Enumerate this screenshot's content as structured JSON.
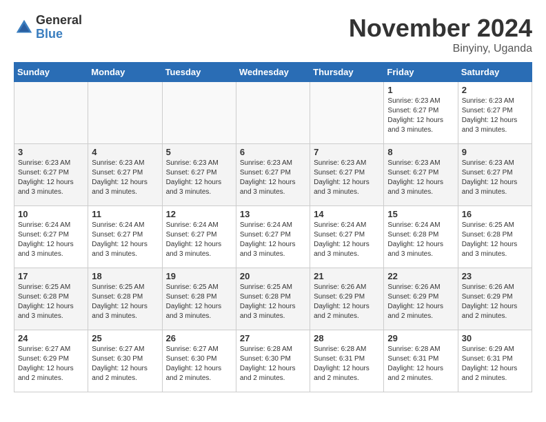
{
  "logo": {
    "general": "General",
    "blue": "Blue"
  },
  "title": "November 2024",
  "location": "Binyiny, Uganda",
  "days_of_week": [
    "Sunday",
    "Monday",
    "Tuesday",
    "Wednesday",
    "Thursday",
    "Friday",
    "Saturday"
  ],
  "weeks": [
    [
      {
        "day": "",
        "info": ""
      },
      {
        "day": "",
        "info": ""
      },
      {
        "day": "",
        "info": ""
      },
      {
        "day": "",
        "info": ""
      },
      {
        "day": "",
        "info": ""
      },
      {
        "day": "1",
        "info": "Sunrise: 6:23 AM\nSunset: 6:27 PM\nDaylight: 12 hours and 3 minutes."
      },
      {
        "day": "2",
        "info": "Sunrise: 6:23 AM\nSunset: 6:27 PM\nDaylight: 12 hours and 3 minutes."
      }
    ],
    [
      {
        "day": "3",
        "info": "Sunrise: 6:23 AM\nSunset: 6:27 PM\nDaylight: 12 hours and 3 minutes."
      },
      {
        "day": "4",
        "info": "Sunrise: 6:23 AM\nSunset: 6:27 PM\nDaylight: 12 hours and 3 minutes."
      },
      {
        "day": "5",
        "info": "Sunrise: 6:23 AM\nSunset: 6:27 PM\nDaylight: 12 hours and 3 minutes."
      },
      {
        "day": "6",
        "info": "Sunrise: 6:23 AM\nSunset: 6:27 PM\nDaylight: 12 hours and 3 minutes."
      },
      {
        "day": "7",
        "info": "Sunrise: 6:23 AM\nSunset: 6:27 PM\nDaylight: 12 hours and 3 minutes."
      },
      {
        "day": "8",
        "info": "Sunrise: 6:23 AM\nSunset: 6:27 PM\nDaylight: 12 hours and 3 minutes."
      },
      {
        "day": "9",
        "info": "Sunrise: 6:23 AM\nSunset: 6:27 PM\nDaylight: 12 hours and 3 minutes."
      }
    ],
    [
      {
        "day": "10",
        "info": "Sunrise: 6:24 AM\nSunset: 6:27 PM\nDaylight: 12 hours and 3 minutes."
      },
      {
        "day": "11",
        "info": "Sunrise: 6:24 AM\nSunset: 6:27 PM\nDaylight: 12 hours and 3 minutes."
      },
      {
        "day": "12",
        "info": "Sunrise: 6:24 AM\nSunset: 6:27 PM\nDaylight: 12 hours and 3 minutes."
      },
      {
        "day": "13",
        "info": "Sunrise: 6:24 AM\nSunset: 6:27 PM\nDaylight: 12 hours and 3 minutes."
      },
      {
        "day": "14",
        "info": "Sunrise: 6:24 AM\nSunset: 6:27 PM\nDaylight: 12 hours and 3 minutes."
      },
      {
        "day": "15",
        "info": "Sunrise: 6:24 AM\nSunset: 6:28 PM\nDaylight: 12 hours and 3 minutes."
      },
      {
        "day": "16",
        "info": "Sunrise: 6:25 AM\nSunset: 6:28 PM\nDaylight: 12 hours and 3 minutes."
      }
    ],
    [
      {
        "day": "17",
        "info": "Sunrise: 6:25 AM\nSunset: 6:28 PM\nDaylight: 12 hours and 3 minutes."
      },
      {
        "day": "18",
        "info": "Sunrise: 6:25 AM\nSunset: 6:28 PM\nDaylight: 12 hours and 3 minutes."
      },
      {
        "day": "19",
        "info": "Sunrise: 6:25 AM\nSunset: 6:28 PM\nDaylight: 12 hours and 3 minutes."
      },
      {
        "day": "20",
        "info": "Sunrise: 6:25 AM\nSunset: 6:28 PM\nDaylight: 12 hours and 3 minutes."
      },
      {
        "day": "21",
        "info": "Sunrise: 6:26 AM\nSunset: 6:29 PM\nDaylight: 12 hours and 2 minutes."
      },
      {
        "day": "22",
        "info": "Sunrise: 6:26 AM\nSunset: 6:29 PM\nDaylight: 12 hours and 2 minutes."
      },
      {
        "day": "23",
        "info": "Sunrise: 6:26 AM\nSunset: 6:29 PM\nDaylight: 12 hours and 2 minutes."
      }
    ],
    [
      {
        "day": "24",
        "info": "Sunrise: 6:27 AM\nSunset: 6:29 PM\nDaylight: 12 hours and 2 minutes."
      },
      {
        "day": "25",
        "info": "Sunrise: 6:27 AM\nSunset: 6:30 PM\nDaylight: 12 hours and 2 minutes."
      },
      {
        "day": "26",
        "info": "Sunrise: 6:27 AM\nSunset: 6:30 PM\nDaylight: 12 hours and 2 minutes."
      },
      {
        "day": "27",
        "info": "Sunrise: 6:28 AM\nSunset: 6:30 PM\nDaylight: 12 hours and 2 minutes."
      },
      {
        "day": "28",
        "info": "Sunrise: 6:28 AM\nSunset: 6:31 PM\nDaylight: 12 hours and 2 minutes."
      },
      {
        "day": "29",
        "info": "Sunrise: 6:28 AM\nSunset: 6:31 PM\nDaylight: 12 hours and 2 minutes."
      },
      {
        "day": "30",
        "info": "Sunrise: 6:29 AM\nSunset: 6:31 PM\nDaylight: 12 hours and 2 minutes."
      }
    ]
  ]
}
